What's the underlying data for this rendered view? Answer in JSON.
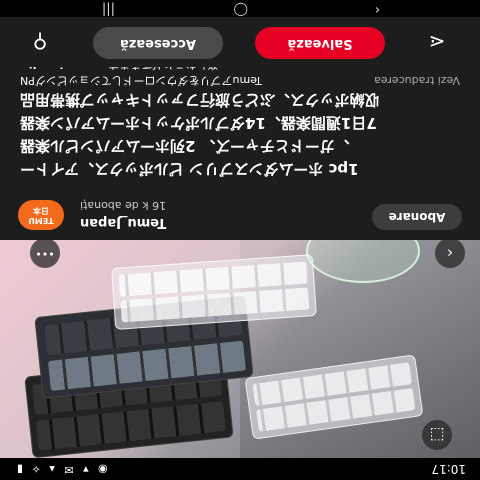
{
  "status_bar": {
    "time": "10:17",
    "icons": "◉ ▾ ✉ ▴ ⟡ ▮"
  },
  "photo": {
    "lens_icon": "⬚",
    "back_icon": "‹",
    "more_icon": "•••"
  },
  "seller": {
    "follow_label": "Abonare",
    "name": "Temu_Japan",
    "followers": "16 k de abonați",
    "logo_line1": "TEMU",
    "logo_line2": "日本"
  },
  "description": {
    "lines": [
      "1pc ホームダンスブリン ピルボックス、アイトー",
      "ガードとチャーズ、 2列ホームアパンピル楽器、",
      "7日1週間楽器、14ダブルポケットホームアパン楽器",
      "収納ボックス、ぶどう旅行ファットキャップ携帯用品"
    ],
    "small_line": "TemuアプリをダウンロードしてショッピングPN",
    "last_line": "楽しむことができます。",
    "more_label": "...mai multe",
    "translate_label": "Vezi traducerea"
  },
  "actions": {
    "pin_icon": "⚲",
    "access_label": "Accesează",
    "save_label": "Salvează",
    "share_icon": "⋖"
  },
  "navbar": {
    "recent": "|||",
    "home": "◯",
    "back": "‹"
  },
  "colors": {
    "save": "#e60023",
    "logo": "#f36a1d",
    "sheet": "#1d1d1d"
  }
}
